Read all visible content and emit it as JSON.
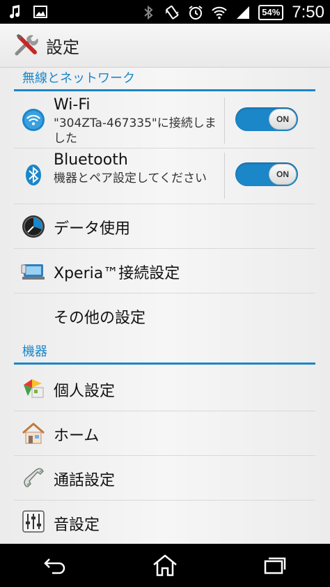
{
  "status_bar": {
    "battery_percent": "54%",
    "time": "7:50",
    "left_icons": [
      "music-icon",
      "image-icon"
    ],
    "right_icons": [
      "bluetooth-icon",
      "vibrate-icon",
      "alarm-icon",
      "wifi-signal-icon",
      "cell-signal-icon"
    ]
  },
  "action_bar": {
    "title": "設定",
    "icon": "settings-tools-icon"
  },
  "sections": {
    "wireless": {
      "label": "無線とネットワーク"
    },
    "device": {
      "label": "機器"
    }
  },
  "items": {
    "wifi": {
      "title": "Wi-Fi",
      "subtitle": "\"304ZTa-467335\"に接続しました",
      "toggle": "ON",
      "icon": "wifi-icon"
    },
    "bluetooth": {
      "title": "Bluetooth",
      "subtitle": "機器とペア設定してください",
      "toggle": "ON",
      "icon": "bluetooth-icon"
    },
    "data_usage": {
      "title": "データ使用",
      "icon": "data-usage-icon"
    },
    "xperia": {
      "title": "Xperia™接続設定",
      "icon": "xperia-connect-icon"
    },
    "more": {
      "title": "その他の設定"
    },
    "personal": {
      "title": "個人設定",
      "icon": "personalization-icon"
    },
    "home": {
      "title": "ホーム",
      "icon": "home-icon"
    },
    "call": {
      "title": "通話設定",
      "icon": "phone-icon"
    },
    "sound": {
      "title": "音設定",
      "icon": "sound-sliders-icon"
    }
  },
  "nav_bar": {
    "buttons": [
      "back-icon",
      "home-icon",
      "recents-icon"
    ]
  },
  "colors": {
    "accent": "#1b86c8",
    "status_bar": "#000000",
    "background": "#efefef"
  }
}
